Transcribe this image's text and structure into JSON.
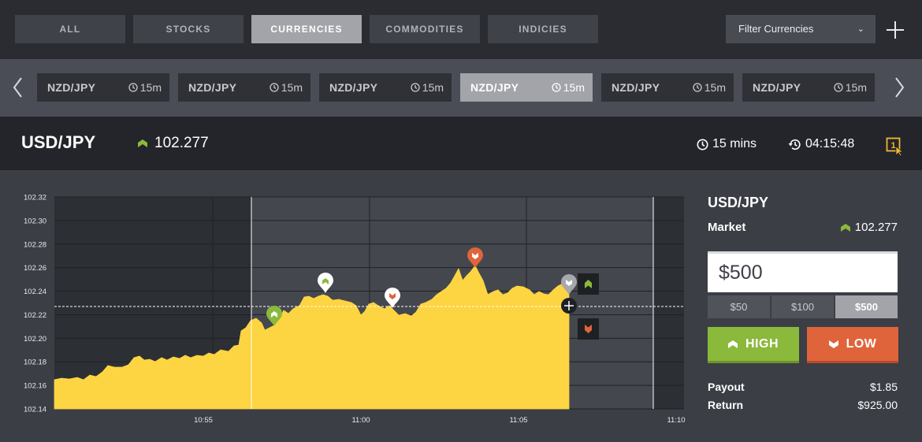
{
  "categories": [
    {
      "label": "ALL",
      "active": false
    },
    {
      "label": "STOCKS",
      "active": false
    },
    {
      "label": "CURRENCIES",
      "active": true
    },
    {
      "label": "COMMODITIES",
      "active": false
    },
    {
      "label": "INDICIES",
      "active": false
    }
  ],
  "filter": {
    "label": "Filter Currencies"
  },
  "pairs": [
    {
      "name": "NZD/JPY",
      "time": "15m",
      "active": false
    },
    {
      "name": "NZD/JPY",
      "time": "15m",
      "active": false
    },
    {
      "name": "NZD/JPY",
      "time": "15m",
      "active": false
    },
    {
      "name": "NZD/JPY",
      "time": "15m",
      "active": true
    },
    {
      "name": "NZD/JPY",
      "time": "15m",
      "active": false
    },
    {
      "name": "NZD/JPY",
      "time": "15m",
      "active": false
    }
  ],
  "instrument": {
    "symbol": "USD/JPY",
    "price": "102.277",
    "duration": "15 mins",
    "countdown": "04:15:48",
    "badge": "1"
  },
  "chart": {
    "y_ticks": [
      "102.32",
      "102.30",
      "102.28",
      "102.26",
      "102.24",
      "102.22",
      "102.20",
      "102.18",
      "102.16",
      "102.14"
    ],
    "x_ticks": [
      "10:55",
      "11:00",
      "11:05",
      "11:10"
    ],
    "current_level": 102.227,
    "fill_color": "#fdd442",
    "up_color": "#8bb93c",
    "down_color": "#e0643b"
  },
  "panel": {
    "symbol": "USD/JPY",
    "market_label": "Market",
    "market_price": "102.277",
    "amount": "$500",
    "presets": [
      {
        "label": "$50",
        "active": false
      },
      {
        "label": "$100",
        "active": false
      },
      {
        "label": "$500",
        "active": true
      }
    ],
    "high_label": "HIGH",
    "low_label": "LOW",
    "payout_label": "Payout",
    "payout_value": "$1.85",
    "return_label": "Return",
    "return_value": "$925.00"
  }
}
